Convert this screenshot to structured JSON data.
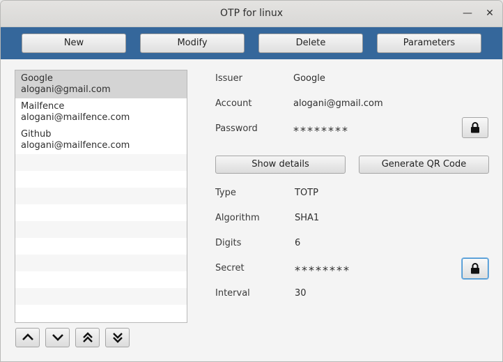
{
  "window": {
    "title": "OTP for linux",
    "minimize_glyph": "—",
    "close_glyph": "✕"
  },
  "toolbar": {
    "new_label": "New",
    "modify_label": "Modify",
    "delete_label": "Delete",
    "parameters_label": "Parameters"
  },
  "accounts": [
    {
      "issuer": "Google",
      "account": "alogani@gmail.com",
      "selected": true
    },
    {
      "issuer": "Mailfence",
      "account": "alogani@mailfence.com",
      "selected": false
    },
    {
      "issuer": "Github",
      "account": "alogani@mailfence.com",
      "selected": false
    }
  ],
  "details": {
    "issuer_label": "Issuer",
    "issuer_value": "Google",
    "account_label": "Account",
    "account_value": "alogani@gmail.com",
    "password_label": "Password",
    "password_value": "********",
    "show_details_label": "Show details",
    "qr_label": "Generate QR Code",
    "type_label": "Type",
    "type_value": "TOTP",
    "algorithm_label": "Algorithm",
    "algorithm_value": "SHA1",
    "digits_label": "Digits",
    "digits_value": "6",
    "secret_label": "Secret",
    "secret_value": "********",
    "interval_label": "Interval",
    "interval_value": "30"
  },
  "icons": {
    "lock": "lock-icon",
    "up": "chevron-up-icon",
    "down": "chevron-down-icon",
    "top": "double-chevron-up-icon",
    "bottom": "double-chevron-down-icon"
  }
}
